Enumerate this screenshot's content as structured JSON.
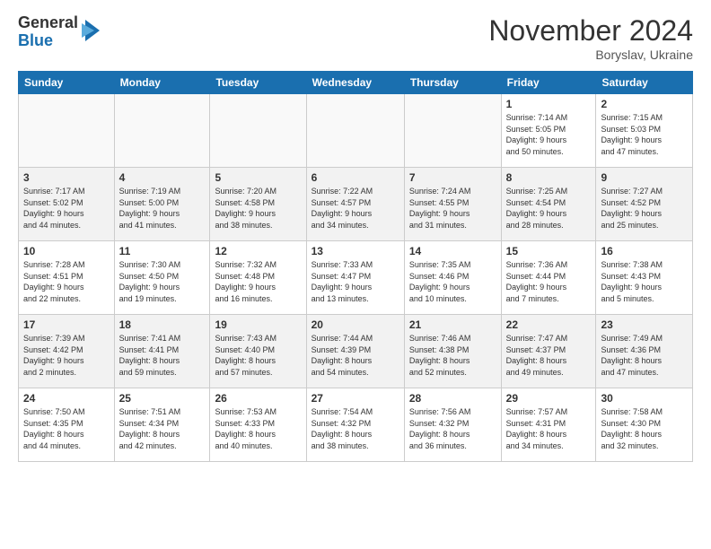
{
  "logo": {
    "general": "General",
    "blue": "Blue"
  },
  "title": "November 2024",
  "location": "Boryslav, Ukraine",
  "headers": [
    "Sunday",
    "Monday",
    "Tuesday",
    "Wednesday",
    "Thursday",
    "Friday",
    "Saturday"
  ],
  "weeks": [
    [
      {
        "day": "",
        "info": ""
      },
      {
        "day": "",
        "info": ""
      },
      {
        "day": "",
        "info": ""
      },
      {
        "day": "",
        "info": ""
      },
      {
        "day": "",
        "info": ""
      },
      {
        "day": "1",
        "info": "Sunrise: 7:14 AM\nSunset: 5:05 PM\nDaylight: 9 hours\nand 50 minutes."
      },
      {
        "day": "2",
        "info": "Sunrise: 7:15 AM\nSunset: 5:03 PM\nDaylight: 9 hours\nand 47 minutes."
      }
    ],
    [
      {
        "day": "3",
        "info": "Sunrise: 7:17 AM\nSunset: 5:02 PM\nDaylight: 9 hours\nand 44 minutes."
      },
      {
        "day": "4",
        "info": "Sunrise: 7:19 AM\nSunset: 5:00 PM\nDaylight: 9 hours\nand 41 minutes."
      },
      {
        "day": "5",
        "info": "Sunrise: 7:20 AM\nSunset: 4:58 PM\nDaylight: 9 hours\nand 38 minutes."
      },
      {
        "day": "6",
        "info": "Sunrise: 7:22 AM\nSunset: 4:57 PM\nDaylight: 9 hours\nand 34 minutes."
      },
      {
        "day": "7",
        "info": "Sunrise: 7:24 AM\nSunset: 4:55 PM\nDaylight: 9 hours\nand 31 minutes."
      },
      {
        "day": "8",
        "info": "Sunrise: 7:25 AM\nSunset: 4:54 PM\nDaylight: 9 hours\nand 28 minutes."
      },
      {
        "day": "9",
        "info": "Sunrise: 7:27 AM\nSunset: 4:52 PM\nDaylight: 9 hours\nand 25 minutes."
      }
    ],
    [
      {
        "day": "10",
        "info": "Sunrise: 7:28 AM\nSunset: 4:51 PM\nDaylight: 9 hours\nand 22 minutes."
      },
      {
        "day": "11",
        "info": "Sunrise: 7:30 AM\nSunset: 4:50 PM\nDaylight: 9 hours\nand 19 minutes."
      },
      {
        "day": "12",
        "info": "Sunrise: 7:32 AM\nSunset: 4:48 PM\nDaylight: 9 hours\nand 16 minutes."
      },
      {
        "day": "13",
        "info": "Sunrise: 7:33 AM\nSunset: 4:47 PM\nDaylight: 9 hours\nand 13 minutes."
      },
      {
        "day": "14",
        "info": "Sunrise: 7:35 AM\nSunset: 4:46 PM\nDaylight: 9 hours\nand 10 minutes."
      },
      {
        "day": "15",
        "info": "Sunrise: 7:36 AM\nSunset: 4:44 PM\nDaylight: 9 hours\nand 7 minutes."
      },
      {
        "day": "16",
        "info": "Sunrise: 7:38 AM\nSunset: 4:43 PM\nDaylight: 9 hours\nand 5 minutes."
      }
    ],
    [
      {
        "day": "17",
        "info": "Sunrise: 7:39 AM\nSunset: 4:42 PM\nDaylight: 9 hours\nand 2 minutes."
      },
      {
        "day": "18",
        "info": "Sunrise: 7:41 AM\nSunset: 4:41 PM\nDaylight: 8 hours\nand 59 minutes."
      },
      {
        "day": "19",
        "info": "Sunrise: 7:43 AM\nSunset: 4:40 PM\nDaylight: 8 hours\nand 57 minutes."
      },
      {
        "day": "20",
        "info": "Sunrise: 7:44 AM\nSunset: 4:39 PM\nDaylight: 8 hours\nand 54 minutes."
      },
      {
        "day": "21",
        "info": "Sunrise: 7:46 AM\nSunset: 4:38 PM\nDaylight: 8 hours\nand 52 minutes."
      },
      {
        "day": "22",
        "info": "Sunrise: 7:47 AM\nSunset: 4:37 PM\nDaylight: 8 hours\nand 49 minutes."
      },
      {
        "day": "23",
        "info": "Sunrise: 7:49 AM\nSunset: 4:36 PM\nDaylight: 8 hours\nand 47 minutes."
      }
    ],
    [
      {
        "day": "24",
        "info": "Sunrise: 7:50 AM\nSunset: 4:35 PM\nDaylight: 8 hours\nand 44 minutes."
      },
      {
        "day": "25",
        "info": "Sunrise: 7:51 AM\nSunset: 4:34 PM\nDaylight: 8 hours\nand 42 minutes."
      },
      {
        "day": "26",
        "info": "Sunrise: 7:53 AM\nSunset: 4:33 PM\nDaylight: 8 hours\nand 40 minutes."
      },
      {
        "day": "27",
        "info": "Sunrise: 7:54 AM\nSunset: 4:32 PM\nDaylight: 8 hours\nand 38 minutes."
      },
      {
        "day": "28",
        "info": "Sunrise: 7:56 AM\nSunset: 4:32 PM\nDaylight: 8 hours\nand 36 minutes."
      },
      {
        "day": "29",
        "info": "Sunrise: 7:57 AM\nSunset: 4:31 PM\nDaylight: 8 hours\nand 34 minutes."
      },
      {
        "day": "30",
        "info": "Sunrise: 7:58 AM\nSunset: 4:30 PM\nDaylight: 8 hours\nand 32 minutes."
      }
    ]
  ]
}
